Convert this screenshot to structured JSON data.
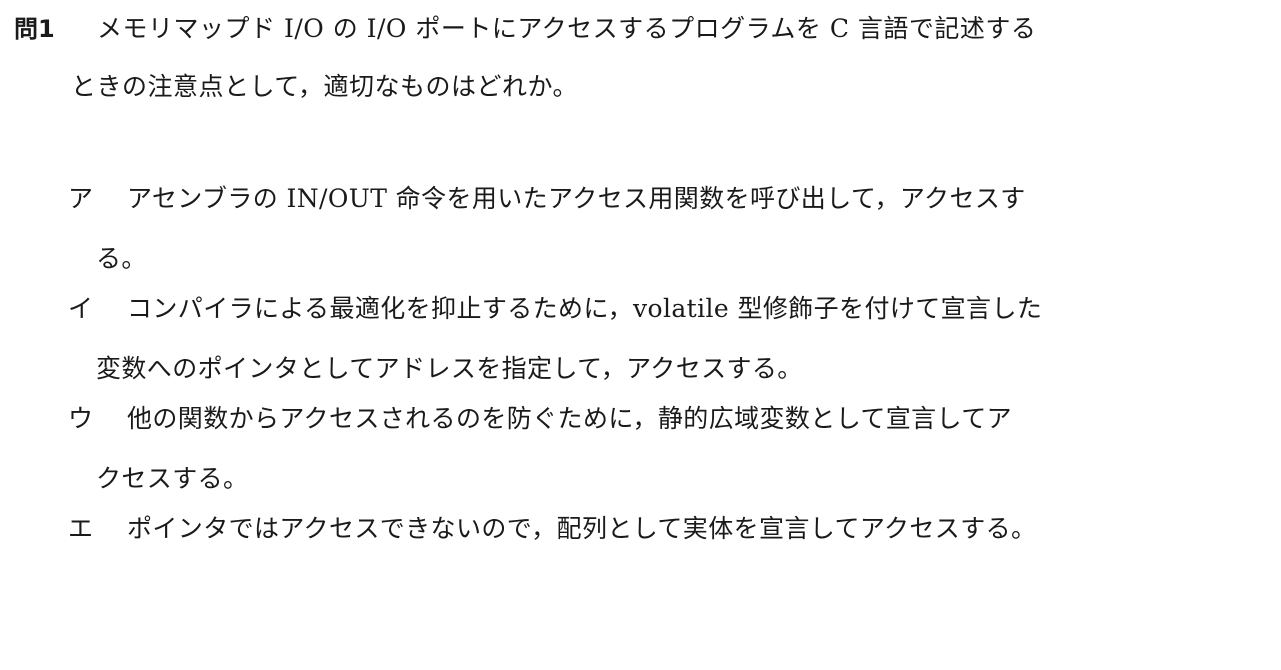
{
  "question": {
    "number": "問1",
    "line1": "メモリマップド I/O の I/O ポートにアクセスするプログラムを C 言語で記述する",
    "line2": "ときの注意点として，適切なものはどれか。"
  },
  "choices": [
    {
      "label": "ア",
      "line1": "アセンブラの IN/OUT 命令を用いたアクセス用関数を呼び出して，アクセスす",
      "line2": "る。"
    },
    {
      "label": "イ",
      "line1": "コンパイラによる最適化を抑止するために，volatile 型修飾子を付けて宣言した",
      "line2": "変数へのポインタとしてアドレスを指定して，アクセスする。"
    },
    {
      "label": "ウ",
      "line1": "他の関数からアクセスされるのを防ぐために，静的広域変数として宣言してア",
      "line2": "クセスする。"
    },
    {
      "label": "エ",
      "line1": "ポインタではアクセスできないので，配列として実体を宣言してアクセスする。",
      "line2": ""
    }
  ]
}
